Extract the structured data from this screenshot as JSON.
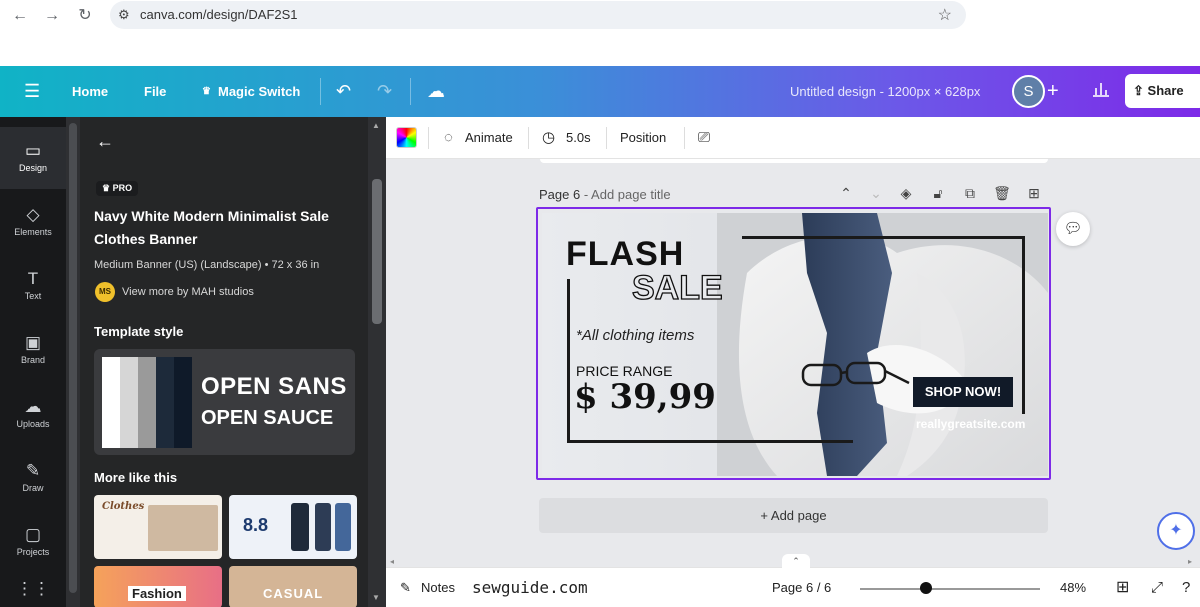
{
  "browser": {
    "back": "←",
    "forward": "→",
    "reload": "↻",
    "url": "canva.com/design/DAF2S1",
    "bookmark": "☆"
  },
  "header": {
    "menu": "☰",
    "home": "Home",
    "file": "File",
    "magic_switch": "Magic Switch",
    "undo": "↶",
    "redo": "↷",
    "cloud": "☁",
    "title": "Untitled design - 1200px × 628px",
    "avatar": "S",
    "add": "+",
    "share": "Share"
  },
  "rail": {
    "items": [
      {
        "label": "Design",
        "icon": "▭"
      },
      {
        "label": "Elements",
        "icon": "◇"
      },
      {
        "label": "Text",
        "icon": "T"
      },
      {
        "label": "Brand",
        "icon": "▣"
      },
      {
        "label": "Uploads",
        "icon": "☁"
      },
      {
        "label": "Draw",
        "icon": "✎"
      },
      {
        "label": "Projects",
        "icon": "▢"
      },
      {
        "label": "",
        "icon": "⋮⋮"
      }
    ]
  },
  "panel": {
    "back": "←",
    "badge": "PRO",
    "template_title": "Navy White Modern Minimalist Sale Clothes Banner",
    "template_meta": "Medium Banner (US) (Landscape) • 72 x 36 in",
    "creator_initials": "MS",
    "creator_link": "View more by MAH studios",
    "style_heading": "Template style",
    "style_font_1": "OPEN SANS",
    "style_font_2": "OPEN SAUCE",
    "swatches": [
      "#ffffff",
      "#d6d6d6",
      "#9a9a9a",
      "#1d2a3a",
      "#0f1a29"
    ],
    "more_heading": "More like this",
    "thumbs": [
      {
        "text": "Clothes"
      },
      {
        "text": "8.8"
      },
      {
        "text": "Fashion"
      },
      {
        "text": "CASUAL"
      }
    ]
  },
  "context_toolbar": {
    "animate": "Animate",
    "duration": "5.0s",
    "position": "Position"
  },
  "canvas": {
    "page_label": "Page 6",
    "page_title_placeholder": "- Add page title",
    "add_page": "+ Add page",
    "design": {
      "flash": "FLASH",
      "sale": "SALE",
      "all_items": "*All clothing items",
      "price_range": "PRICE RANGE",
      "price": "$ 39,99",
      "cta": "SHOP NOW!",
      "site": "reallygreatsite.com"
    }
  },
  "footer": {
    "notes": "Notes",
    "watermark": "sewguide.com",
    "page_indicator": "Page 6 / 6",
    "zoom": "48%",
    "zoom_fraction": 0.48
  },
  "colors": {
    "accent": "#7d2ae8",
    "header_start": "#10b3c6",
    "header_end": "#7d2ae8",
    "panel_bg": "#252627",
    "rail_bg": "#18191b"
  }
}
